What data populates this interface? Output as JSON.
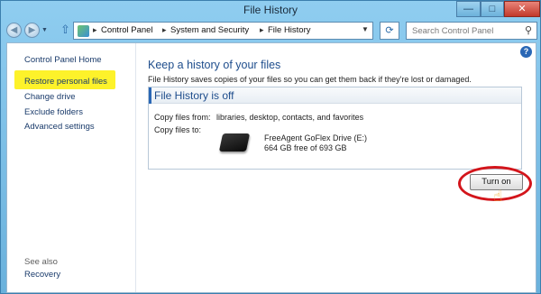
{
  "window": {
    "title": "File History",
    "minimize": "—",
    "maximize": "□",
    "close": "✕"
  },
  "nav": {
    "back_icon": "back-arrow-icon",
    "forward_icon": "forward-arrow-icon",
    "up_icon": "up-arrow-icon",
    "breadcrumb": [
      "Control Panel",
      "System and Security",
      "File History"
    ],
    "search_placeholder": "Search Control Panel"
  },
  "sidebar": {
    "home": "Control Panel Home",
    "items": [
      {
        "label": "Restore personal files",
        "highlighted": true
      },
      {
        "label": "Change drive"
      },
      {
        "label": "Exclude folders"
      },
      {
        "label": "Advanced settings"
      }
    ],
    "see_also": "See also",
    "recovery": "Recovery"
  },
  "main": {
    "title": "Keep a history of your files",
    "description": "File History saves copies of your files so you can get them back if they're lost or damaged.",
    "status": {
      "title": "File History is off",
      "copy_from_label": "Copy files from:",
      "copy_from_value": "libraries, desktop, contacts, and favorites",
      "copy_to_label": "Copy files to:",
      "drive_name": "FreeAgent GoFlex Drive (E:)",
      "drive_space": "664 GB free of 693 GB"
    },
    "turn_on_button": "Turn on"
  },
  "colors": {
    "highlight": "#fdf22a",
    "annotation_circle": "#d3151b",
    "title_blue": "#1e4d8c",
    "link_blue": "#1a3b6b"
  }
}
